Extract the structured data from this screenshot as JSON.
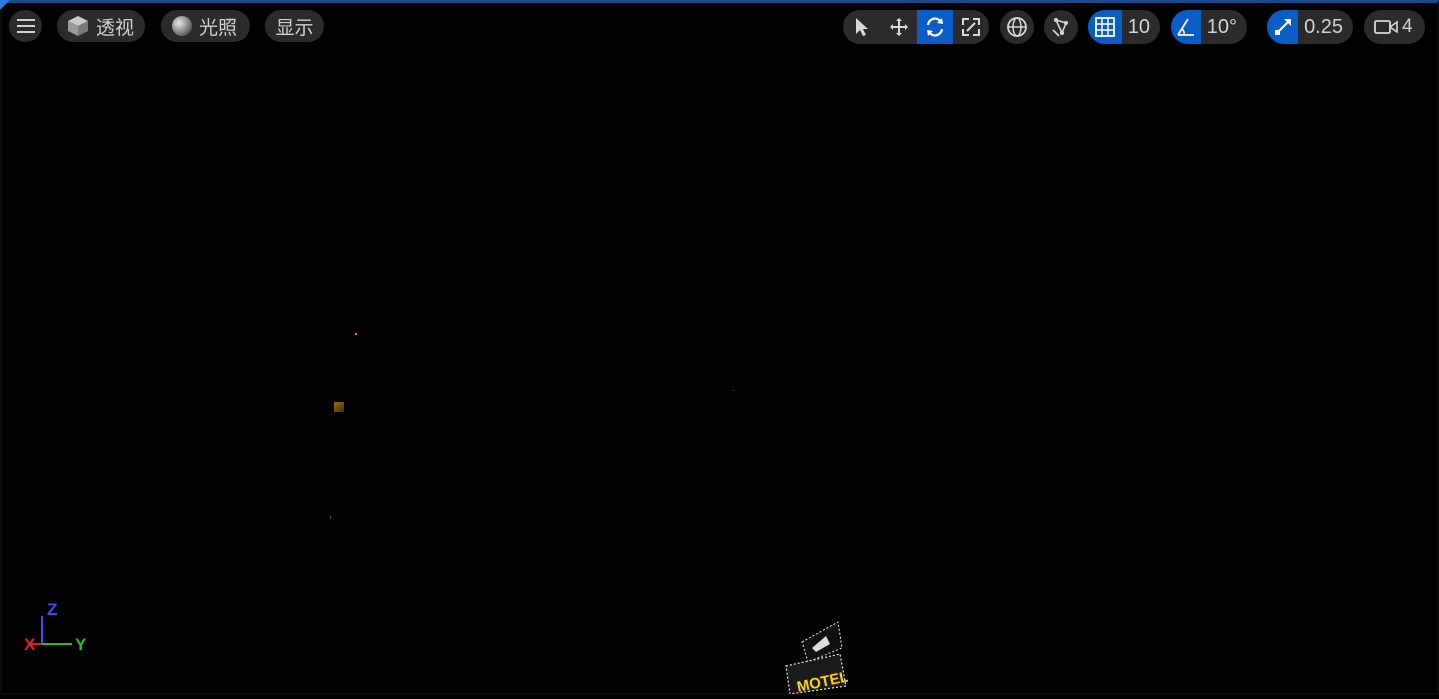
{
  "toolbar": {
    "menu_icon": "hamburger-icon",
    "view_mode": {
      "icon": "cube-icon",
      "label": "透视"
    },
    "lighting": {
      "icon": "sphere-icon",
      "label": "光照"
    },
    "show_label": "显示",
    "transform_tools": [
      {
        "name": "select",
        "icon": "cursor-icon",
        "active": false
      },
      {
        "name": "translate",
        "icon": "move-icon",
        "active": false
      },
      {
        "name": "rotate",
        "icon": "rotate-icon",
        "active": true
      },
      {
        "name": "scale",
        "icon": "scale-icon",
        "active": false
      }
    ],
    "world_local_icon": "globe-icon",
    "surface_snap_icon": "surface-snap-icon",
    "grid_snap": {
      "icon": "grid-icon",
      "value": "10",
      "active": true
    },
    "rotation_snap": {
      "icon": "angle-icon",
      "value": "10°",
      "active": true
    },
    "scale_snap": {
      "icon": "scale-arrow-icon",
      "value": "0.25",
      "active": true
    },
    "camera_speed": {
      "icon": "camera-icon",
      "value": "4"
    }
  },
  "axis_gizmo": {
    "z": "Z",
    "x": "X",
    "y": "Y",
    "colors": {
      "z": "#3a4fff",
      "x": "#e02020",
      "y": "#22c022"
    }
  },
  "scene": {
    "background": "#020202",
    "accent": "#0a5cc7",
    "sign_text": "MOTEL"
  }
}
